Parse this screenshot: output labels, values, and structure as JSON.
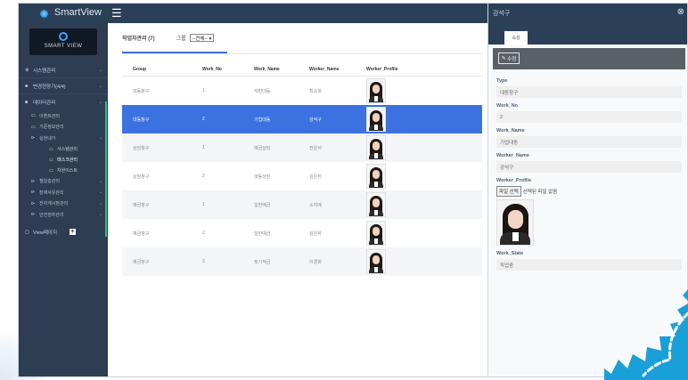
{
  "app": {
    "brand": "SmartView",
    "logo_text": "SMART VIEW"
  },
  "sidebar": {
    "items": [
      {
        "label": "시스템관리",
        "icon": "gear-icon"
      },
      {
        "label": "변경현장기(4/4)",
        "icon": "sitemap-icon"
      },
      {
        "label": "데이터관리",
        "icon": "list-icon"
      }
    ],
    "sub_items": [
      {
        "label": "이벤트관리"
      },
      {
        "label": "기준정보관리"
      },
      {
        "label": "실현내가"
      }
    ],
    "sub_sub_items": [
      {
        "label": "사스템관리"
      },
      {
        "label": "태스크관리"
      },
      {
        "label": "차원이스트"
      }
    ],
    "more_items": [
      {
        "label": "챔일층관리"
      },
      {
        "label": "장애사유관리"
      },
      {
        "label": "전자계시판관리"
      },
      {
        "label": "안전점추관리"
      }
    ],
    "view_page": "View페이지"
  },
  "main": {
    "title": "작업자관리 (7)",
    "group_label": "그룹",
    "group_select": "--전체-- ▾",
    "columns": [
      "Group",
      "Work_No",
      "Work_Name",
      "Worker_Name",
      "Worker_Profile"
    ],
    "rows": [
      {
        "group": "대동창구",
        "no": "1",
        "name": "자판대동",
        "worker": "최소희"
      },
      {
        "group": "대동창구",
        "no": "2",
        "name": "기업대동",
        "worker": "강석구"
      },
      {
        "group": "상담창구",
        "no": "1",
        "name": "예금상담",
        "worker": "전은서"
      },
      {
        "group": "상담창구",
        "no": "2",
        "name": "대동상담",
        "worker": "김은지"
      },
      {
        "group": "예금창구",
        "no": "1",
        "name": "일반예금",
        "worker": "소지애"
      },
      {
        "group": "예금창구",
        "no": "2",
        "name": "일반예금",
        "worker": "심은하"
      },
      {
        "group": "예금창구",
        "no": "3",
        "name": "정기적금",
        "worker": "이경희"
      }
    ]
  },
  "panel": {
    "title": "강석구",
    "close": "⊗",
    "tab": "속성",
    "edit_button": "수정",
    "fields": {
      "type_label": "Type",
      "type_value": "대동창구",
      "work_no_label": "Work_No",
      "work_no_value": "2",
      "work_name_label": "Work_Name",
      "work_name_value": "기업대동",
      "worker_name_label": "Worker_Name",
      "worker_name_value": "강석구",
      "worker_profile_label": "Worker_Profile",
      "file_button": "파일 선택",
      "file_status": "선택된 파일 없음",
      "work_state_label": "Work_State",
      "work_state_value": "작업중"
    }
  },
  "colors": {
    "topbar": "#2b3f57",
    "sidebar": "#2d3e52",
    "selected_row": "#3b72e0",
    "accent_green": "#27c46a",
    "badge": "#1aa0d8"
  }
}
